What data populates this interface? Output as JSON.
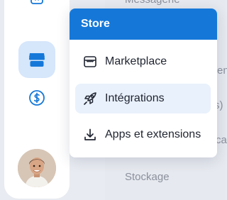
{
  "background": {
    "items": [
      "Messagerie",
      "en",
      "s)",
      "ca",
      "Stockage"
    ]
  },
  "sidebar": {
    "icons": [
      "code-icon",
      "store-icon",
      "dollar-icon"
    ],
    "active": "store"
  },
  "menu": {
    "title": "Store",
    "items": [
      {
        "label": "Marketplace",
        "icon": "storefront-icon",
        "active": false
      },
      {
        "label": "Intégrations",
        "icon": "rocket-icon",
        "active": true
      },
      {
        "label": "Apps et extensions",
        "icon": "download-icon",
        "active": false
      }
    ]
  },
  "colors": {
    "accent": "#1578d9",
    "active_bg": "#e9f1fc",
    "rail_active_bg": "#d6e6fb"
  }
}
